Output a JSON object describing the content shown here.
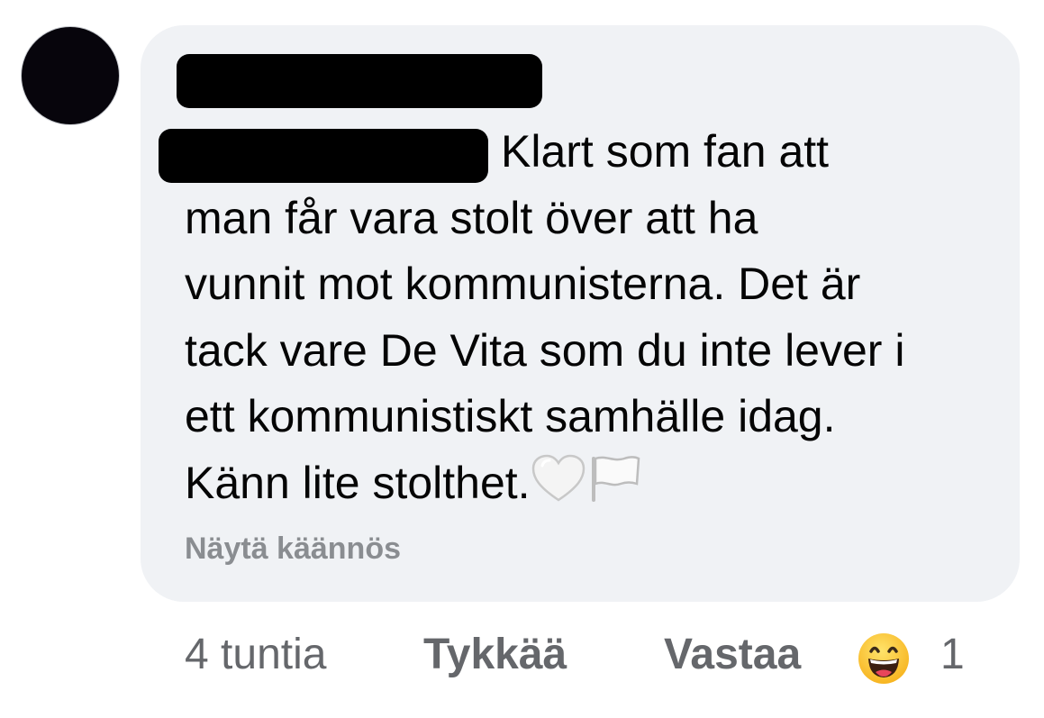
{
  "comment": {
    "lines": [
      "Klart som fan att",
      "man får vara stolt över att ha",
      "vunnit mot kommunisterna. Det är",
      "tack vare De Vita som du inte lever i",
      "ett kommunistiskt samhälle idag.",
      "Känn lite stolthet."
    ],
    "translate_label": "Näytä käännös"
  },
  "actions": {
    "time": "4 tuntia",
    "like_label": "Tykkää",
    "reply_label": "Vastaa",
    "reaction_icon": "grinning-face-icon",
    "reaction_count": "1"
  },
  "icons": {
    "heart": "white-heart-icon",
    "flag": "white-flag-icon"
  },
  "colors": {
    "bubble": "#f0f2f5",
    "text": "#050505",
    "secondary": "#65676b",
    "link": "#8a8d91"
  }
}
